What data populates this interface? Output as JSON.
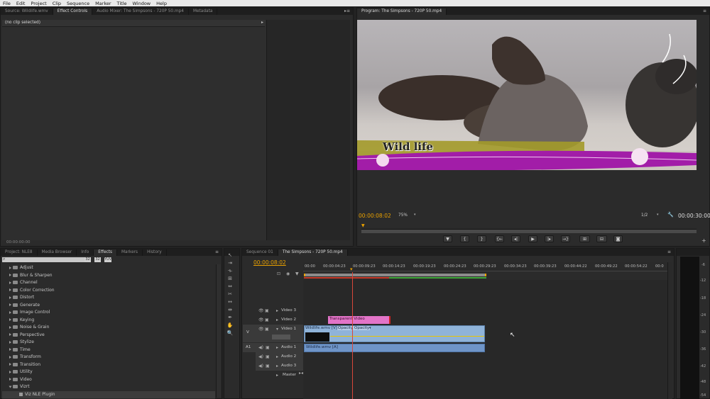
{
  "menu": [
    "File",
    "Edit",
    "Project",
    "Clip",
    "Sequence",
    "Marker",
    "Title",
    "Window",
    "Help"
  ],
  "source_panel": {
    "tabs": [
      "Source: Wildlife.wmv",
      "Effect Controls",
      "Audio Mixer: The Simpsons - 720P 50.mp4",
      "Metadata"
    ],
    "active_tab": 1,
    "status": "(no clip selected)",
    "timecode": "00:00:00:00"
  },
  "program_panel": {
    "tab": "Program: The Simpsons - 720P 50.mp4",
    "title_overlay": "Wild life",
    "timecode_current": "00:00:08:02",
    "zoom": "75%",
    "resolution": "1/2",
    "timecode_duration": "00:00:30:00"
  },
  "project_panel": {
    "tabs": [
      "Project: NLE8",
      "Media Browser",
      "Info",
      "Effects",
      "Markers",
      "History"
    ],
    "active_tab": 3,
    "search_placeholder": "",
    "folders": [
      "Adjust",
      "Blur & Sharpen",
      "Channel",
      "Color Correction",
      "Distort",
      "Generate",
      "Image Control",
      "Keying",
      "Noise & Grain",
      "Perspective",
      "Stylize",
      "Time",
      "Transform",
      "Transition",
      "Utility",
      "Video",
      "Vizrt"
    ],
    "plugin": "Viz NLE Plugin"
  },
  "timeline": {
    "tabs": [
      "Sequence 01",
      "The Simpsons - 720P 50.mp4"
    ],
    "active_tab": 1,
    "timecode": "00:00:08:02",
    "ruler": [
      "00:00",
      "00:00:04:23",
      "00:00:09:23",
      "00:00:14:23",
      "00:00:19:23",
      "00:00:24:23",
      "00:00:29:23",
      "00:00:34:23",
      "00:00:39:23",
      "00:00:44:22",
      "00:00:49:22",
      "00:00:54:22",
      "00:0"
    ],
    "tracks": {
      "video3": "Video 3",
      "video2": "Video 2",
      "video1": "Video 1",
      "audio1": "Audio 1",
      "audio2": "Audio 2",
      "audio3": "Audio 3",
      "master": "Master"
    },
    "v_label": "V",
    "a_label": "A1",
    "clips": {
      "transparent": "Transparent Video",
      "wildlife_video": "Wildlife.wmv [V]",
      "opacity1": "Opacity",
      "opacity2": "Opacity",
      "wildlife_audio": "Wildlife.wmv [A]"
    }
  },
  "meter": {
    "labels": [
      "-6",
      "-12",
      "-18",
      "-24",
      "-30",
      "-36",
      "-42",
      "-48",
      "-54"
    ]
  },
  "colors": {
    "accent": "#e8a000",
    "playhead": "#d8473b",
    "video_clip": "#8fb3d9",
    "audio_clip": "#6f95c8",
    "transparent_clip": "#e374c8"
  }
}
